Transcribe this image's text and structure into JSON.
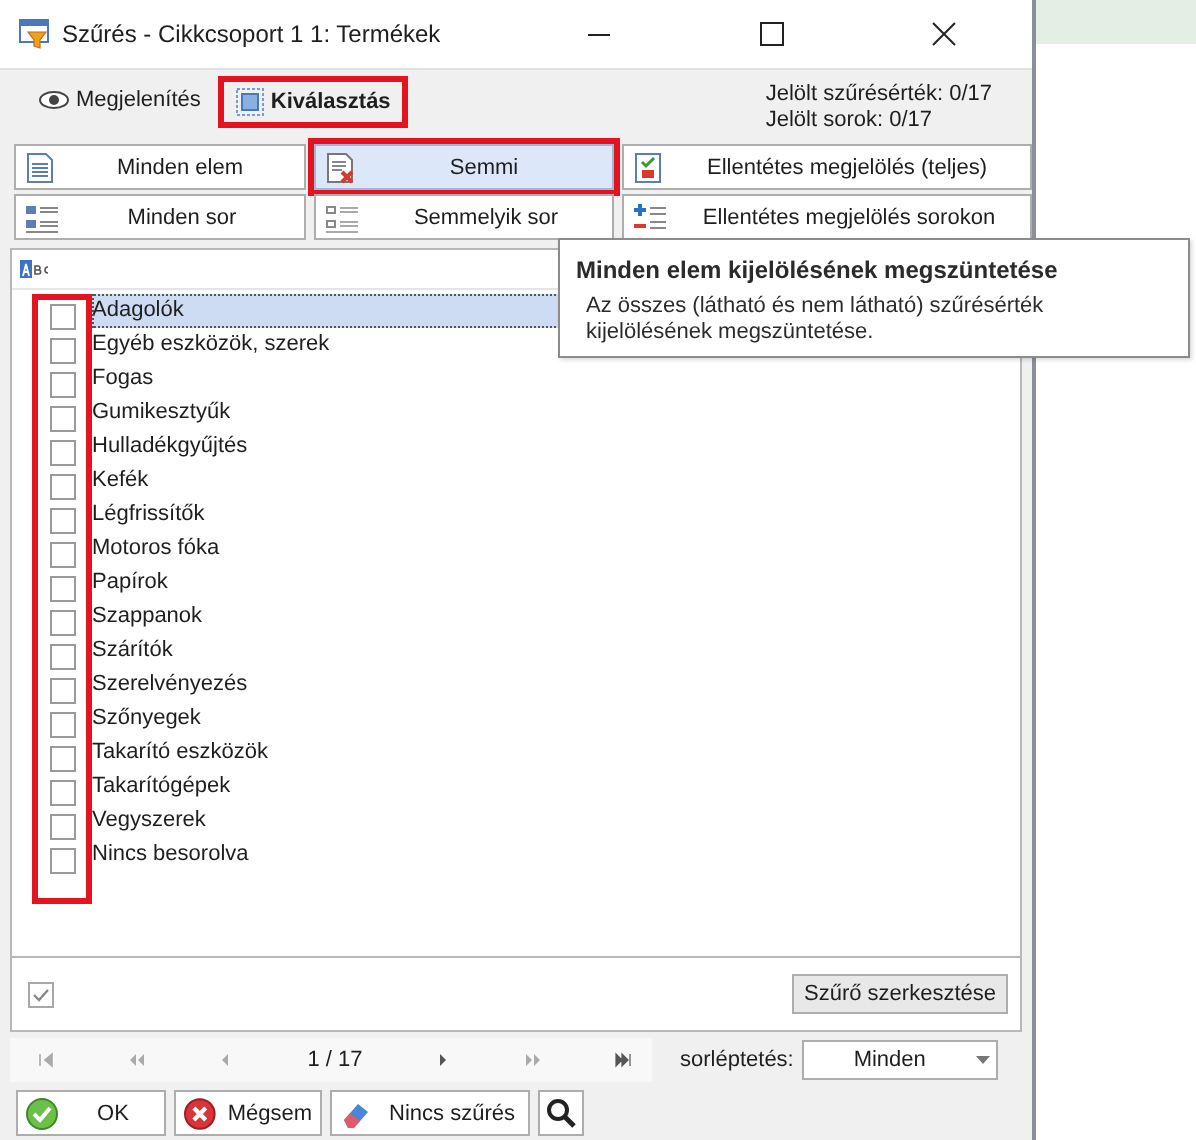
{
  "window": {
    "title": "Szűrés - Cikkcsoport 1 1: Termékek"
  },
  "tabs": [
    {
      "label": "Megjelenítés",
      "selected": false,
      "highlighted": false
    },
    {
      "label": "Kiválasztás",
      "selected": true,
      "highlighted": true
    }
  ],
  "counts": [
    "Jelölt szűrésérték: 0/17",
    "Jelölt sorok: 0/17"
  ],
  "action_buttons": [
    {
      "label": "Minden elem",
      "highlighted": false,
      "hovered": false
    },
    {
      "label": "Semmi",
      "highlighted": true,
      "hovered": true
    },
    {
      "label": "Ellentétes megjelölés (teljes)",
      "highlighted": false,
      "hovered": false
    },
    {
      "label": "Minden sor",
      "highlighted": false,
      "hovered": false
    },
    {
      "label": "Semmelyik sor",
      "highlighted": false,
      "hovered": false
    },
    {
      "label": "Ellentétes megjelölés sorokon",
      "highlighted": false,
      "hovered": false
    }
  ],
  "list": {
    "checkbox_column_highlighted": true,
    "items": [
      {
        "label": "Adagolók",
        "checked": false,
        "selected": true
      },
      {
        "label": "Egyéb eszközök, szerek",
        "checked": false,
        "selected": false
      },
      {
        "label": "Fogas",
        "checked": false,
        "selected": false
      },
      {
        "label": "Gumikesztyűk",
        "checked": false,
        "selected": false
      },
      {
        "label": "Hulladékgyűjtés",
        "checked": false,
        "selected": false
      },
      {
        "label": "Kefék",
        "checked": false,
        "selected": false
      },
      {
        "label": "Légfrissítők",
        "checked": false,
        "selected": false
      },
      {
        "label": "Motoros fóka",
        "checked": false,
        "selected": false
      },
      {
        "label": "Papírok",
        "checked": false,
        "selected": false
      },
      {
        "label": "Szappanok",
        "checked": false,
        "selected": false
      },
      {
        "label": "Szárítók",
        "checked": false,
        "selected": false
      },
      {
        "label": "Szerelvényezés",
        "checked": false,
        "selected": false
      },
      {
        "label": "Szőnyegek",
        "checked": false,
        "selected": false
      },
      {
        "label": "Takarító eszközök",
        "checked": false,
        "selected": false
      },
      {
        "label": "Takarítógépek",
        "checked": false,
        "selected": false
      },
      {
        "label": "Vegyszerek",
        "checked": false,
        "selected": false
      },
      {
        "label": "Nincs besorolva",
        "checked": false,
        "selected": false
      }
    ]
  },
  "select_all": {
    "checked": true
  },
  "edit_filter_button": "Szűrő szerkesztése",
  "navigator": {
    "position": "1 / 17",
    "label": "sorléptetés:",
    "dropdown": {
      "value": "Minden"
    }
  },
  "dialog_buttons": [
    "OK",
    "Mégsem",
    "Nincs szűrés"
  ],
  "tooltip": {
    "title": "Minden elem kijelölésének megszüntetése",
    "text": "Az összes  (látható és nem látható) szűrésérték kijelölésének megszüntetése."
  }
}
